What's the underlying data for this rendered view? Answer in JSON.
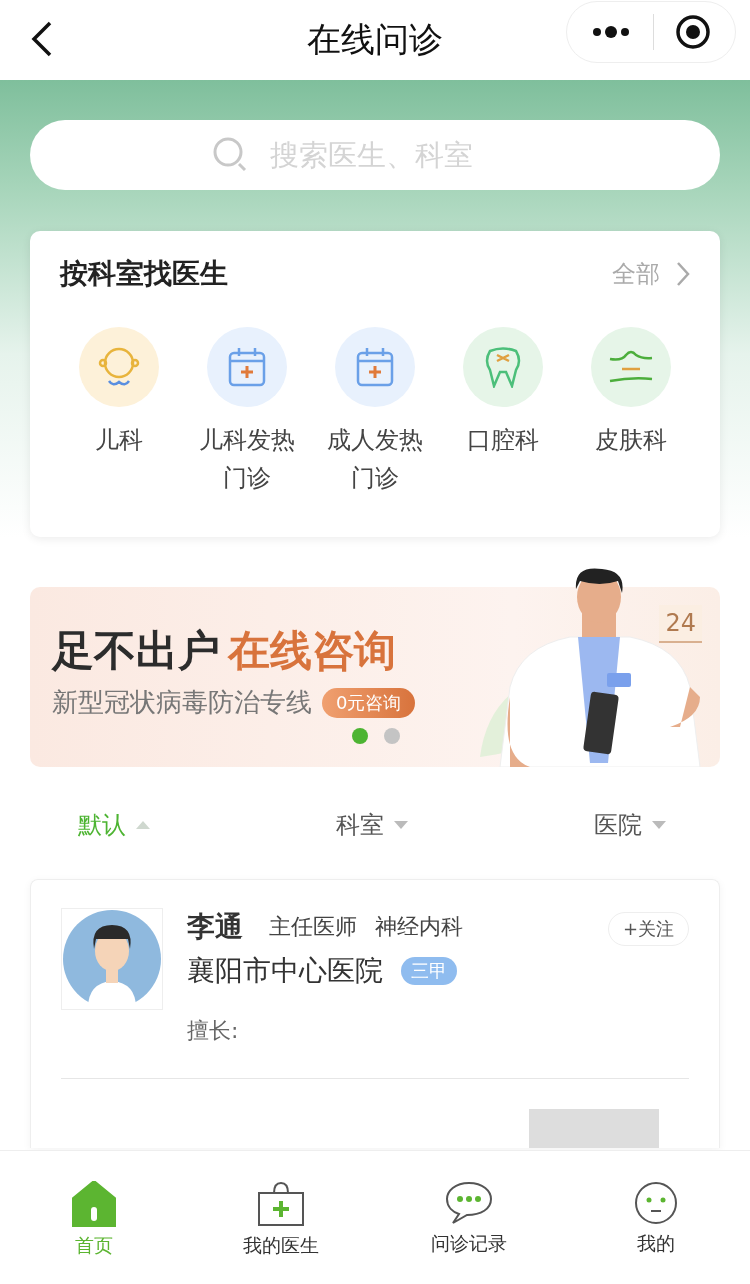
{
  "nav": {
    "title": "在线问诊"
  },
  "search": {
    "placeholder": "搜索医生、科室"
  },
  "departments": {
    "title": "按科室找医生",
    "more": "全部",
    "items": [
      {
        "label": "儿科",
        "kind": "baby"
      },
      {
        "label": "儿科发热门诊",
        "kind": "calendar"
      },
      {
        "label": "成人发热门诊",
        "kind": "calendar"
      },
      {
        "label": "口腔科",
        "kind": "tooth"
      },
      {
        "label": "皮肤科",
        "kind": "skin"
      }
    ]
  },
  "banner": {
    "headline": "足不出户",
    "headline_accent": "在线咨询",
    "subtitle": "新型冠状病毒防治专线",
    "badge": "0元咨询",
    "calendar_day": "24",
    "dots": [
      {
        "selected": true
      },
      {
        "selected": false
      }
    ]
  },
  "filters": [
    {
      "label": "默认",
      "selected": true
    },
    {
      "label": "科室",
      "selected": false
    },
    {
      "label": "医院",
      "selected": false
    }
  ],
  "doctor": {
    "name": "李通",
    "title": "主任医师",
    "department": "神经内科",
    "hospital": "襄阳市中心医院",
    "grade": "三甲",
    "follow": "+关注",
    "expertise_label": "擅长:"
  },
  "tabbar": [
    {
      "label": "首页",
      "kind": "home",
      "selected": true
    },
    {
      "label": "我的医生",
      "kind": "kit",
      "selected": false
    },
    {
      "label": "问诊记录",
      "kind": "chat",
      "selected": false
    },
    {
      "label": "我的",
      "kind": "face",
      "selected": false
    }
  ]
}
